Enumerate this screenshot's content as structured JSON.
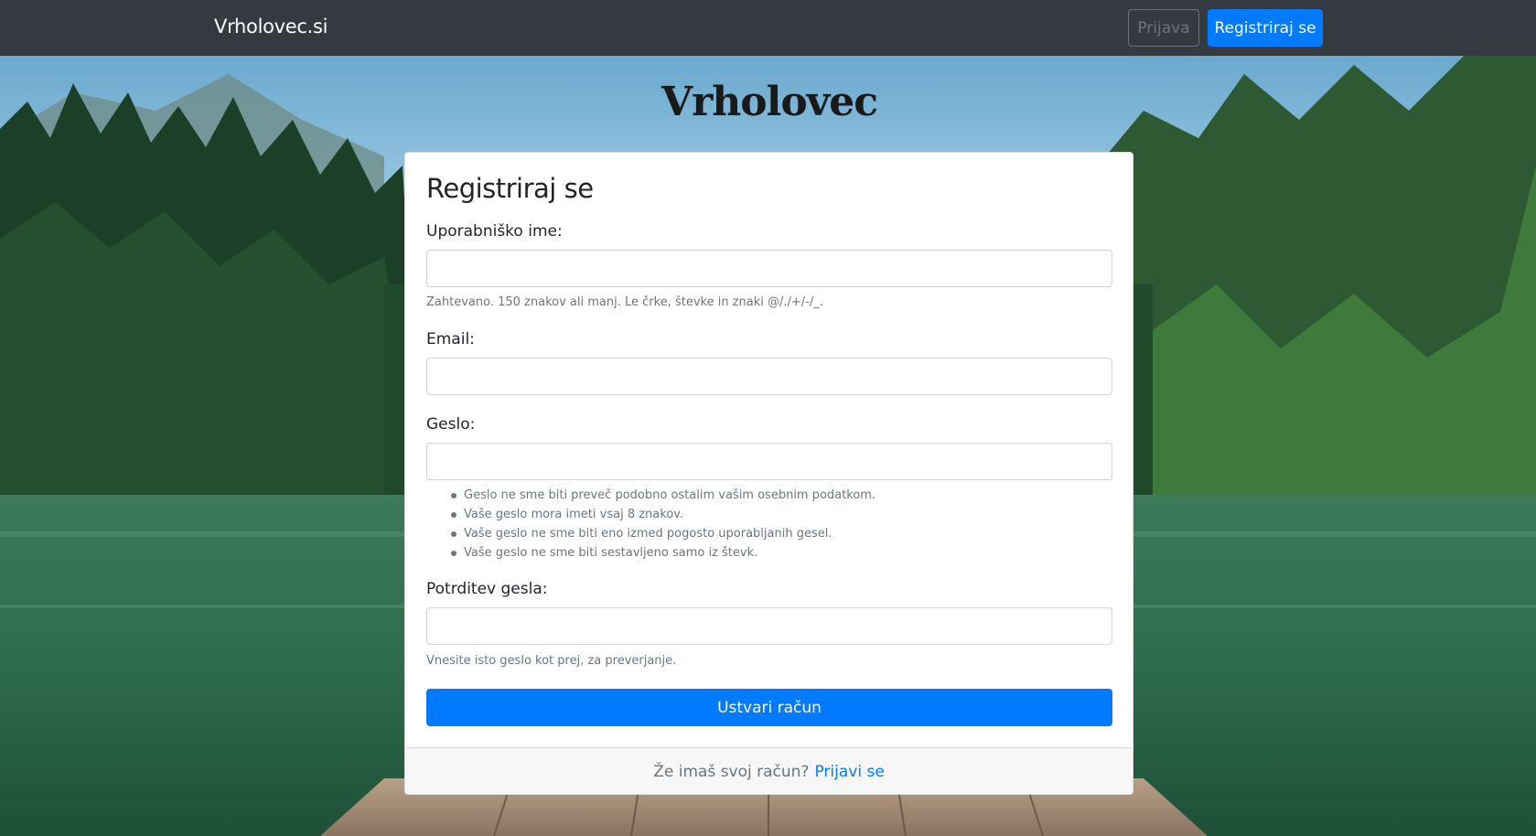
{
  "navbar": {
    "brand": "Vrholovec.si",
    "login_label": "Prijava",
    "register_label": "Registriraj se"
  },
  "logo": {
    "text": "Vrholovec"
  },
  "form": {
    "title": "Registriraj se",
    "username": {
      "label": "Uporabniško ime:",
      "value": "",
      "help": "Zahtevano. 150 znakov ali manj. Le črke, števke in znaki @/./+/-/_."
    },
    "email": {
      "label": "Email:",
      "value": ""
    },
    "password": {
      "label": "Geslo:",
      "value": "",
      "rules": [
        "Geslo ne sme biti preveč podobno ostalim vašim osebnim podatkom.",
        "Vaše geslo mora imeti vsaj 8 znakov.",
        "Vaše geslo ne sme biti eno izmed pogosto uporabljanih gesel.",
        "Vaše geslo ne sme biti sestavljeno samo iz števk."
      ]
    },
    "password_confirm": {
      "label": "Potrditev gesla:",
      "value": "",
      "help": "Vnesite isto geslo kot prej, za preverjanje."
    },
    "submit_label": "Ustvari račun"
  },
  "footer": {
    "question": "Že imaš svoj račun?",
    "link_label": "Prijavi se"
  },
  "colors": {
    "navbar_bg": "#343a40",
    "primary": "#007bff",
    "muted": "#6c757d"
  }
}
